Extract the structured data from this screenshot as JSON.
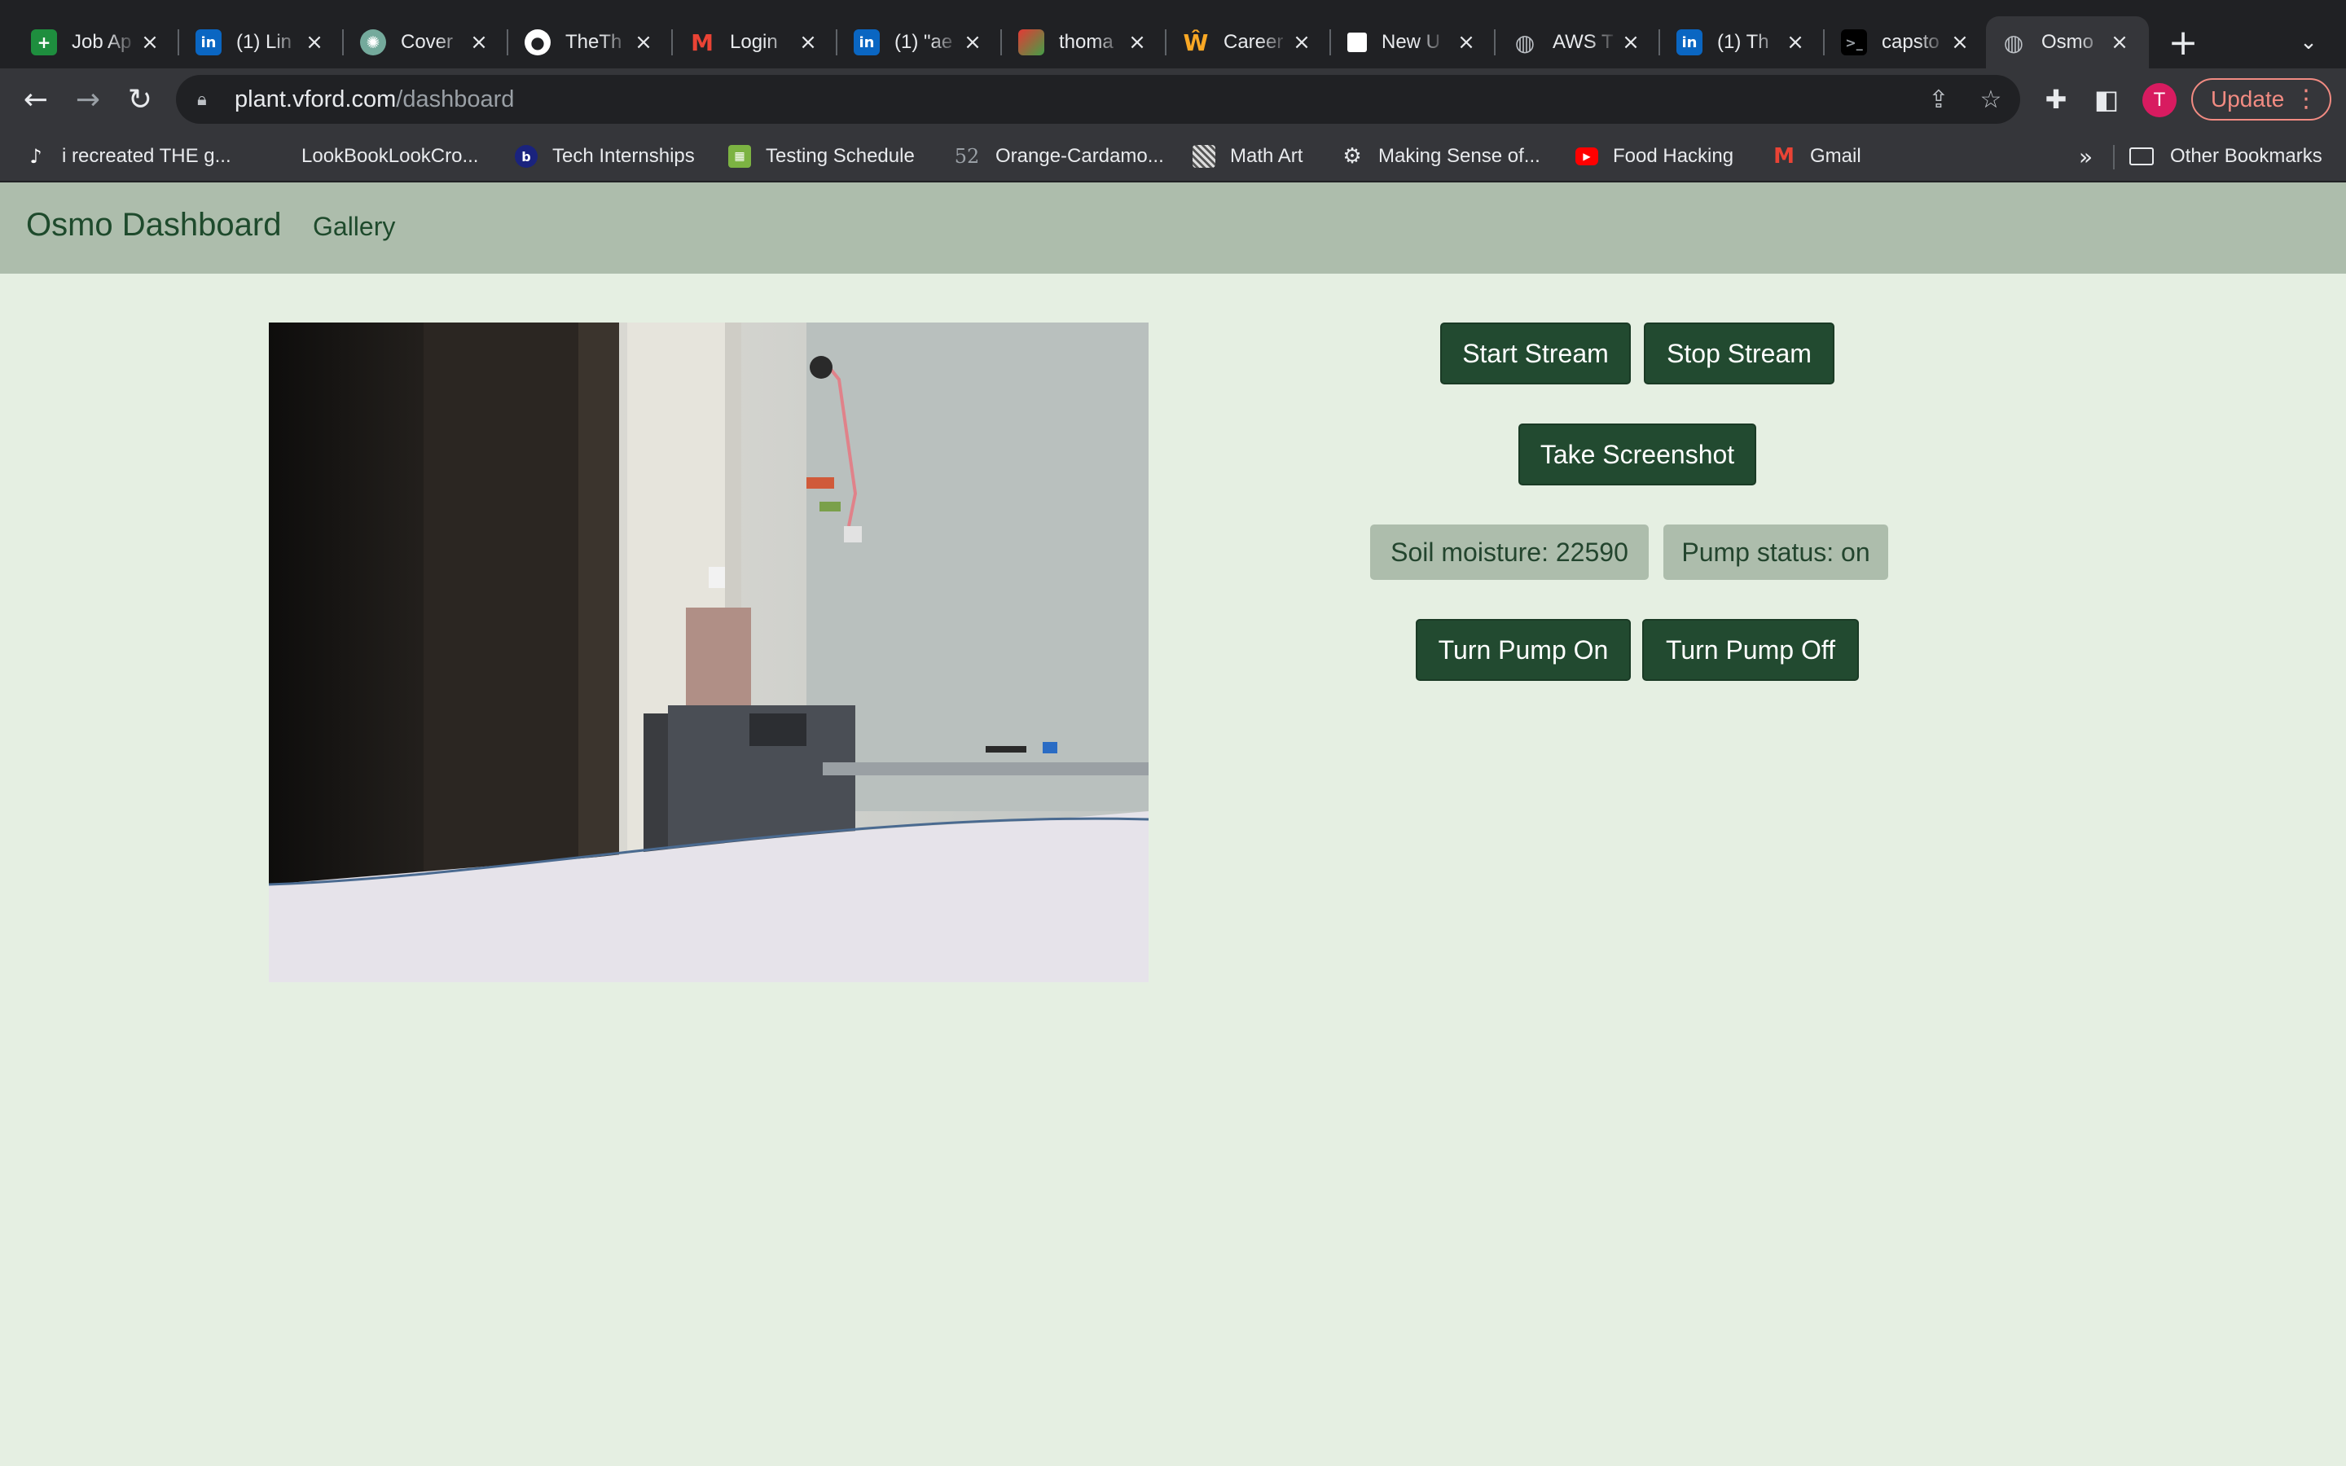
{
  "browser": {
    "tabs": [
      {
        "title": "Job Ap",
        "icon": "google-sheets-icon"
      },
      {
        "title": "(1) Lin",
        "icon": "linkedin-icon"
      },
      {
        "title": "Cover",
        "icon": "chatgpt-icon"
      },
      {
        "title": "TheTh",
        "icon": "github-icon"
      },
      {
        "title": "Login",
        "icon": "gmail-icon"
      },
      {
        "title": "(1) \"ae",
        "icon": "linkedin-icon"
      },
      {
        "title": "thoma",
        "icon": "colorful-plant-icon"
      },
      {
        "title": "Career",
        "icon": "career-portal-icon"
      },
      {
        "title": "New U",
        "icon": "notion-icon"
      },
      {
        "title": "AWS T",
        "icon": "globe-icon"
      },
      {
        "title": "(1) Th",
        "icon": "linkedin-icon"
      },
      {
        "title": "capsto",
        "icon": "terminal-icon"
      },
      {
        "title": "Osmo",
        "icon": "globe-icon"
      }
    ],
    "url_host": "plant.vford.com",
    "url_path": "/dashboard",
    "profile_initial": "T",
    "update_label": "Update",
    "bookmarks": [
      {
        "label": "i recreated THE g...",
        "icon": "tiktok-icon"
      },
      {
        "label": "LookBookLookCro...",
        "icon": "blank-page-icon"
      },
      {
        "label": "Tech Internships",
        "icon": "bold-b-icon"
      },
      {
        "label": "Testing Schedule",
        "icon": "calendar-sheet-icon"
      },
      {
        "label": "Orange-Cardamo...",
        "icon": "food52-icon"
      },
      {
        "label": "Math Art",
        "icon": "pattern-icon"
      },
      {
        "label": "Making Sense of...",
        "icon": "gear-logo-icon"
      },
      {
        "label": "Food Hacking",
        "icon": "youtube-icon"
      },
      {
        "label": "Gmail",
        "icon": "gmail-icon"
      }
    ],
    "more_bookmarks": "»",
    "other_bookmarks": "Other Bookmarks"
  },
  "page": {
    "brand": "Osmo Dashboard",
    "nav_gallery": "Gallery",
    "buttons": {
      "start_stream": "Start Stream",
      "stop_stream": "Stop Stream",
      "take_screenshot": "Take Screenshot",
      "pump_on": "Turn Pump On",
      "pump_off": "Turn Pump Off"
    },
    "status": {
      "soil_moisture": "Soil moisture: 22590",
      "pump_status": "Pump status: on"
    }
  },
  "colors": {
    "page_bg": "#e5efe2",
    "navbar_bg": "#adbdac",
    "button_bg": "#224a30",
    "badge_bg": "#adbdac"
  }
}
